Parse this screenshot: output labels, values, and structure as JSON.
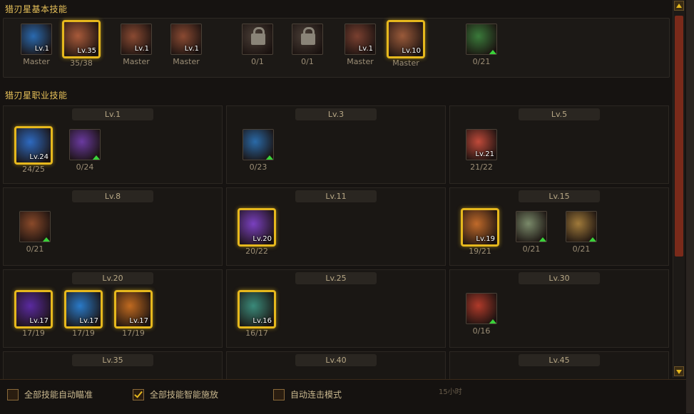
{
  "sections": {
    "basic_title": "猎刃星基本技能",
    "class_title": "猎刃星职业技能"
  },
  "basic_skills": [
    {
      "icon": "warrior-aura-icon",
      "lv": "Lv.1",
      "caption": "Master",
      "selected": false,
      "color": "#2a6ab0"
    },
    {
      "icon": "slash-strike-icon",
      "lv": "Lv.35",
      "caption": "35/38",
      "selected": true,
      "color": "#a85a3a"
    },
    {
      "icon": "blade-combo-icon",
      "lv": "Lv.1",
      "caption": "Master",
      "selected": false,
      "color": "#8a4a32"
    },
    {
      "icon": "blade-combo-2-icon",
      "lv": "Lv.1",
      "caption": "Master",
      "selected": false,
      "color": "#8a4a32"
    },
    {
      "icon": "lock-icon",
      "lv": "",
      "caption": "0/1",
      "selected": false,
      "locked": true,
      "color": "#4a3e36"
    },
    {
      "icon": "lock-icon",
      "lv": "",
      "caption": "0/1",
      "selected": false,
      "locked": true,
      "color": "#4a3e36"
    },
    {
      "icon": "spark-blade-icon",
      "lv": "Lv.1",
      "caption": "Master",
      "selected": false,
      "color": "#7a4030"
    },
    {
      "icon": "bronze-claw-icon",
      "lv": "Lv.10",
      "caption": "Master",
      "selected": true,
      "color": "#9a5a3a"
    },
    {
      "icon": "green-dash-icon",
      "lv": "",
      "caption": "0/21",
      "selected": false,
      "upgrade": true,
      "color": "#3a7a3a"
    }
  ],
  "tiers": [
    {
      "label": "Lv.1",
      "skills": [
        {
          "icon": "throwing-dagger-icon",
          "lv": "Lv.24",
          "caption": "24/25",
          "selected": true,
          "color": "#2e6ac0"
        },
        {
          "icon": "purple-palm-icon",
          "lv": "",
          "caption": "0/24",
          "selected": false,
          "upgrade": true,
          "color": "#6a3aa0"
        }
      ]
    },
    {
      "label": "Lv.3",
      "skills": [
        {
          "icon": "blue-vortex-icon",
          "lv": "",
          "caption": "0/23",
          "selected": false,
          "upgrade": true,
          "color": "#2a6aa8"
        }
      ]
    },
    {
      "label": "Lv.5",
      "skills": [
        {
          "icon": "crimson-blade-icon",
          "lv": "Lv.21",
          "caption": "21/22",
          "selected": false,
          "color": "#c04a3a"
        }
      ]
    },
    {
      "label": "Lv.8",
      "skills": [
        {
          "icon": "flame-burst-icon",
          "lv": "",
          "caption": "0/21",
          "selected": false,
          "upgrade": true,
          "color": "#8a4a2a"
        }
      ]
    },
    {
      "label": "Lv.11",
      "skills": [
        {
          "icon": "violet-crescent-icon",
          "lv": "Lv.20",
          "caption": "20/22",
          "selected": true,
          "color": "#7a40c0"
        }
      ]
    },
    {
      "label": "Lv.15",
      "skills": [
        {
          "icon": "orange-explosion-icon",
          "lv": "Lv.19",
          "caption": "19/21",
          "selected": true,
          "color": "#c06a2a"
        },
        {
          "icon": "silver-spread-icon",
          "lv": "",
          "caption": "0/21",
          "selected": false,
          "upgrade": true,
          "color": "#7a8a6a"
        },
        {
          "icon": "golden-fan-icon",
          "lv": "",
          "caption": "0/21",
          "selected": false,
          "upgrade": true,
          "color": "#a07a3a"
        }
      ]
    },
    {
      "label": "Lv.20",
      "skills": [
        {
          "icon": "shadow-leap-icon",
          "lv": "Lv.17",
          "caption": "17/19",
          "selected": true,
          "color": "#5a2aa0"
        },
        {
          "icon": "azure-slash-icon",
          "lv": "Lv.17",
          "caption": "17/19",
          "selected": true,
          "color": "#2a7ac8"
        },
        {
          "icon": "fire-knife-icon",
          "lv": "Lv.17",
          "caption": "17/19",
          "selected": true,
          "color": "#c06a20"
        }
      ]
    },
    {
      "label": "Lv.25",
      "skills": [
        {
          "icon": "spinning-wheel-icon",
          "lv": "Lv.16",
          "caption": "16/17",
          "selected": true,
          "color": "#3a8a7a"
        }
      ]
    },
    {
      "label": "Lv.30",
      "skills": [
        {
          "icon": "red-dagger-rain-icon",
          "lv": "",
          "caption": "0/16",
          "selected": false,
          "upgrade": true,
          "color": "#b03a2a"
        }
      ]
    },
    {
      "label": "Lv.35",
      "skills": []
    },
    {
      "label": "Lv.40",
      "skills": []
    },
    {
      "label": "Lv.45",
      "skills": []
    }
  ],
  "options": [
    {
      "label": "全部技能自动瞄准",
      "checked": false
    },
    {
      "label": "全部技能智能施放",
      "checked": true
    },
    {
      "label": "自动连击模式",
      "checked": false
    }
  ],
  "hint": "15小时"
}
